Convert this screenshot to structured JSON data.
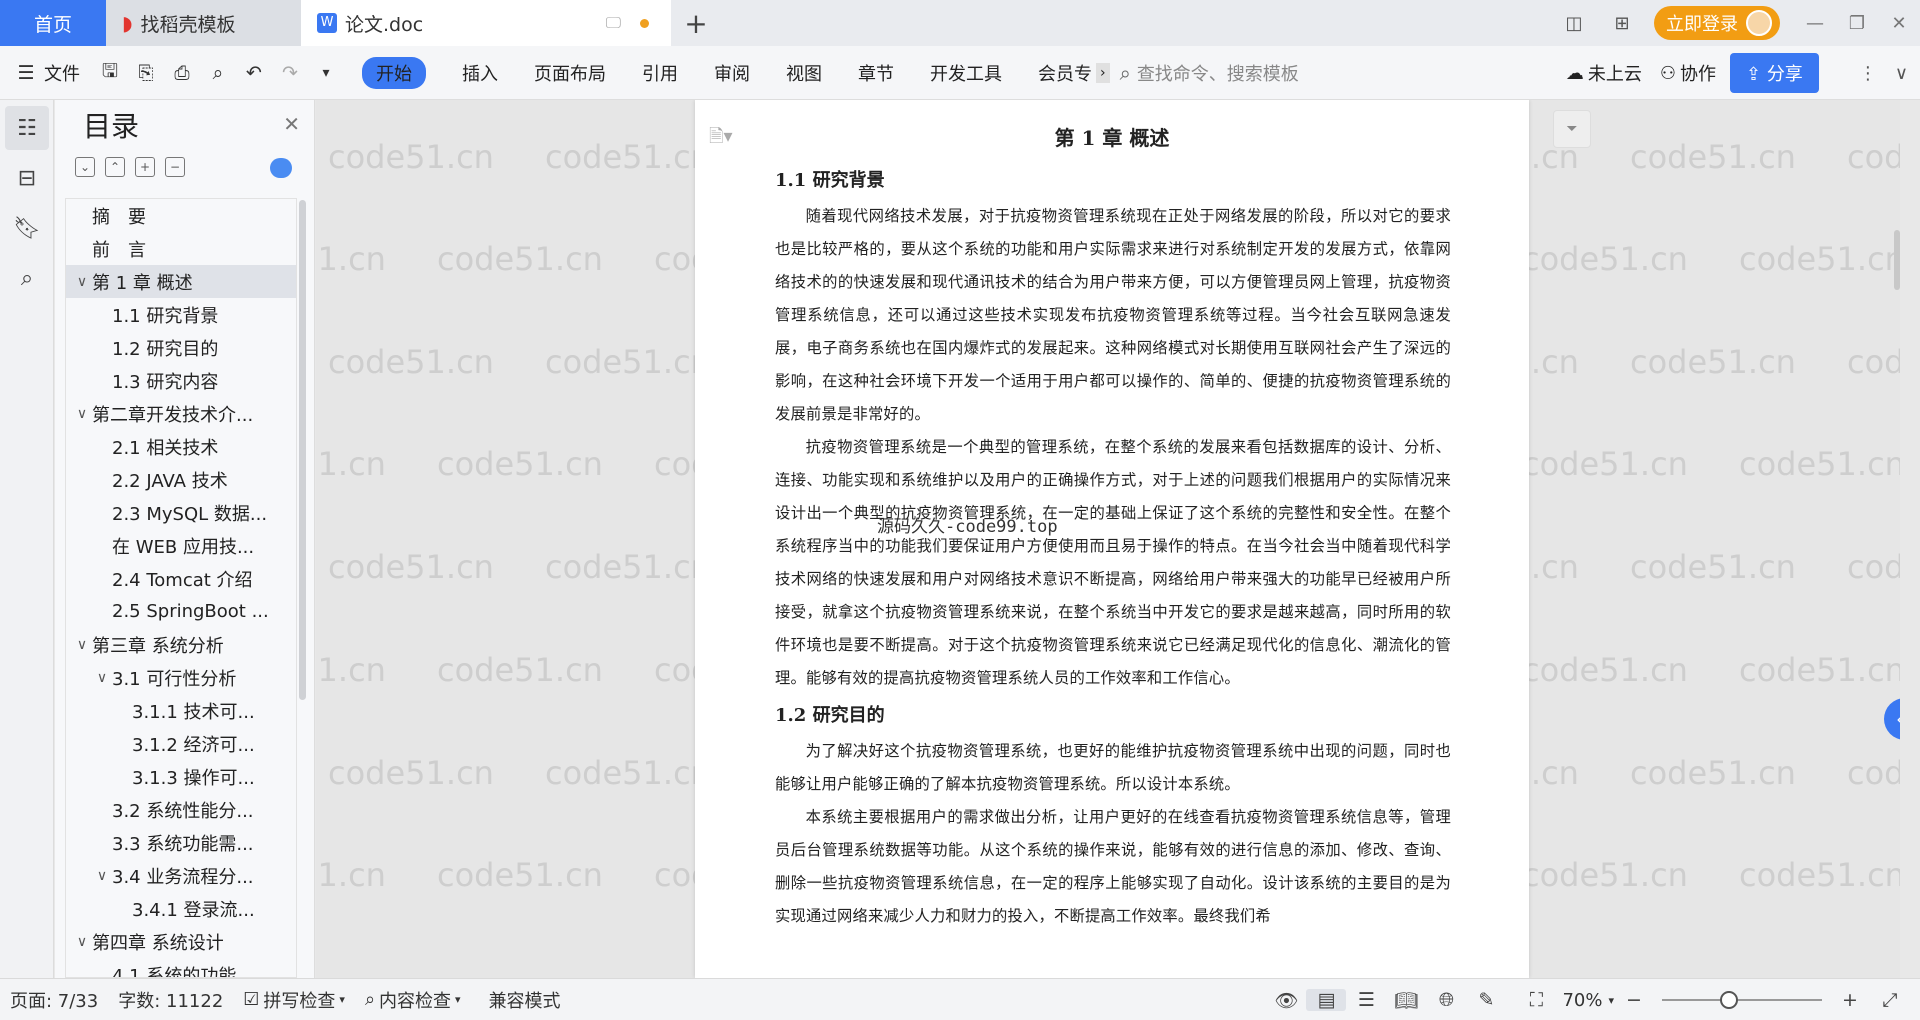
{
  "titlebar": {
    "tabs": [
      {
        "label": "首页"
      },
      {
        "label": "找稻壳模板"
      },
      {
        "label": "论文.doc"
      }
    ],
    "new_tab": "+",
    "login_label": "立即登录"
  },
  "ribbon": {
    "file_label": "文件",
    "tabs": [
      "开始",
      "插入",
      "页面布局",
      "引用",
      "审阅",
      "视图",
      "章节",
      "开发工具",
      "会员专"
    ],
    "search_placeholder": "查找命令、搜索模板",
    "cloud_label": "未上云",
    "collab_label": "协作",
    "share_label": "分享"
  },
  "toc": {
    "title": "目录",
    "items": [
      {
        "label": "摘　要",
        "level": 0,
        "arrow": ""
      },
      {
        "label": "前　言",
        "level": 0,
        "arrow": ""
      },
      {
        "label": "第 1 章  概述",
        "level": 0,
        "arrow": "∨",
        "selected": true
      },
      {
        "label": "1.1  研究背景",
        "level": 1,
        "arrow": ""
      },
      {
        "label": "1.2  研究目的",
        "level": 1,
        "arrow": ""
      },
      {
        "label": "1.3  研究内容",
        "level": 1,
        "arrow": ""
      },
      {
        "label": "第二章开发技术介...",
        "level": 0,
        "arrow": "∨"
      },
      {
        "label": "2.1 相关技术",
        "level": 1,
        "arrow": ""
      },
      {
        "label": "2.2 JAVA 技术",
        "level": 1,
        "arrow": ""
      },
      {
        "label": "2.3 MySQL 数据...",
        "level": 1,
        "arrow": ""
      },
      {
        "label": "在 WEB 应用技...",
        "level": 1,
        "arrow": ""
      },
      {
        "label": "2.4 Tomcat 介绍",
        "level": 1,
        "arrow": ""
      },
      {
        "label": "2.5 SpringBoot ...",
        "level": 1,
        "arrow": ""
      },
      {
        "label": "第三章  系统分析",
        "level": 0,
        "arrow": "∨"
      },
      {
        "label": "3.1  可行性分析",
        "level": 1,
        "arrow": "∨"
      },
      {
        "label": "3.1.1   技术可...",
        "level": 2,
        "arrow": ""
      },
      {
        "label": "3.1.2  经济可...",
        "level": 2,
        "arrow": ""
      },
      {
        "label": "3.1.3  操作可...",
        "level": 2,
        "arrow": ""
      },
      {
        "label": "3.2  系统性能分...",
        "level": 1,
        "arrow": ""
      },
      {
        "label": "3.3  系统功能需...",
        "level": 1,
        "arrow": ""
      },
      {
        "label": "3.4  业务流程分...",
        "level": 1,
        "arrow": "∨"
      },
      {
        "label": "3.4.1 登录流...",
        "level": 2,
        "arrow": ""
      },
      {
        "label": " 第四章  系统设计",
        "level": 0,
        "arrow": "∨"
      },
      {
        "label": "4.1  系统的功能",
        "level": 1,
        "arrow": ""
      }
    ]
  },
  "document": {
    "chapter_title": "第 1 章  概述",
    "sections": [
      {
        "heading": "1.1  研究背景",
        "paragraphs": [
          "随着现代网络技术发展，对于抗疫物资管理系统现在正处于网络发展的阶段，所以对它的要求也是比较严格的，要从这个系统的功能和用户实际需求来进行对系统制定开发的发展方式，依靠网络技术的的快速发展和现代通讯技术的结合为用户带来方便，可以方便管理员网上管理，抗疫物资管理系统信息，还可以通过这些技术实现发布抗疫物资管理系统等过程。当今社会互联网急速发展，电子商务系统也在国内爆炸式的发展起来。这种网络模式对长期使用互联网社会产生了深远的影响，在这种社会环境下开发一个适用于用户都可以操作的、简单的、便捷的抗疫物资管理系统的发展前景是非常好的。",
          "抗疫物资管理系统是一个典型的管理系统，在整个系统的发展来看包括数据库的设计、分析、连接、功能实现和系统维护以及用户的正确操作方式，对于上述的问题我们根据用户的实际情况来设计出一个典型的抗疫物资管理系统，在一定的基础上保证了这个系统的完整性和安全性。在整个系统程序当中的功能我们要保证用户方便使用而且易于操作的特点。在当今社会当中随着现代科学技术网络的快速发展和用户对网络技术意识不断提高，网络给用户带来强大的功能早已经被用户所接受，就拿这个抗疫物资管理系统来说，在整个系统当中开发它的要求是越来越高，同时所用的软件环境也是要不断提高。对于这个抗疫物资管理系统来说它已经满足现代化的信息化、潮流化的管理。能够有效的提高抗疫物资管理系统人员的工作效率和工作信心。"
        ]
      },
      {
        "heading": "1.2  研究目的",
        "paragraphs": [
          "为了解决好这个抗疫物资管理系统，也更好的能维护抗疫物资管理系统中出现的问题，同时也能够让用户能够正确的了解本抗疫物资管理系统。所以设计本系统。",
          "本系统主要根据用户的需求做出分析，让用户更好的在线查看抗疫物资管理系统信息等，管理员后台管理系统数据等功能。从这个系统的操作来说，能够有效的进行信息的添加、修改、查询、删除一些抗疫物资管理系统信息，在一定的程序上能够实现了自动化。设计该系统的主要目的是为实现通过网络来减少人力和财力的投入，不断提高工作效率。最终我们希"
        ]
      }
    ],
    "overlay_watermark": "源码久久-code99.top",
    "watermark": "code51.cn"
  },
  "status": {
    "page": "页面: 7/33",
    "words": "字数: 11122",
    "spell": "拼写检查",
    "content_check": "内容检查",
    "compat": "兼容模式",
    "zoom": "70%"
  }
}
